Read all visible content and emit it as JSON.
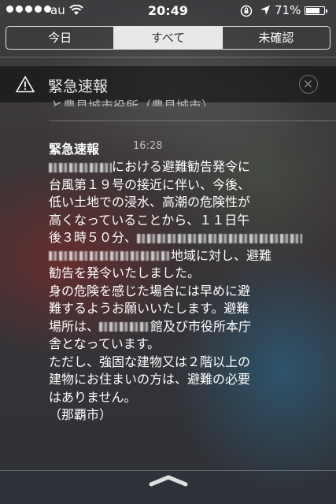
{
  "status_bar": {
    "carrier": "au",
    "time": "20:49",
    "battery_percent": "71%",
    "battery_level": 0.71
  },
  "tabs": [
    {
      "label": "今日",
      "selected": false
    },
    {
      "label": "すべて",
      "selected": true
    },
    {
      "label": "未確認",
      "selected": false
    }
  ],
  "section": {
    "title": "緊急速報",
    "icon": "warning-triangle-icon",
    "clear_icon": "clear-circle-x-icon"
  },
  "previous_notification_cutoff": "と豊見城市役所（豊見城市）",
  "notification": {
    "title": "緊急速報",
    "time": "16:28",
    "lines": [
      {
        "pre": "",
        "post": "における避難勧告発令に"
      },
      {
        "text": "台風第１９号の接近に伴い、今後、"
      },
      {
        "text": "低い土地での浸水、高潮の危険性が"
      },
      {
        "text": "高くなっていることから、１１日午"
      },
      {
        "pre": "後３時５０分、",
        "post": ""
      },
      {
        "pre": "",
        "post": "地域に対し、避難"
      },
      {
        "text": "勧告を発令いたしました。"
      },
      {
        "text": "身の危険を感じた場合には早めに避"
      },
      {
        "text": "難するようお願いいたします。避難"
      },
      {
        "pre": "場所は、",
        "post": "館及び市役所本庁"
      },
      {
        "text": "舎となっています。"
      },
      {
        "text": "ただし、強固な建物又は２階以上の"
      },
      {
        "text": "建物にお住まいの方は、避難の必要"
      },
      {
        "text": "はありません。"
      },
      {
        "text": "（那覇市）"
      }
    ]
  },
  "colors": {
    "tab_selected_bg": "#e8e8e8",
    "text": "#ffffff",
    "secondary_text": "#bbbbbb"
  }
}
